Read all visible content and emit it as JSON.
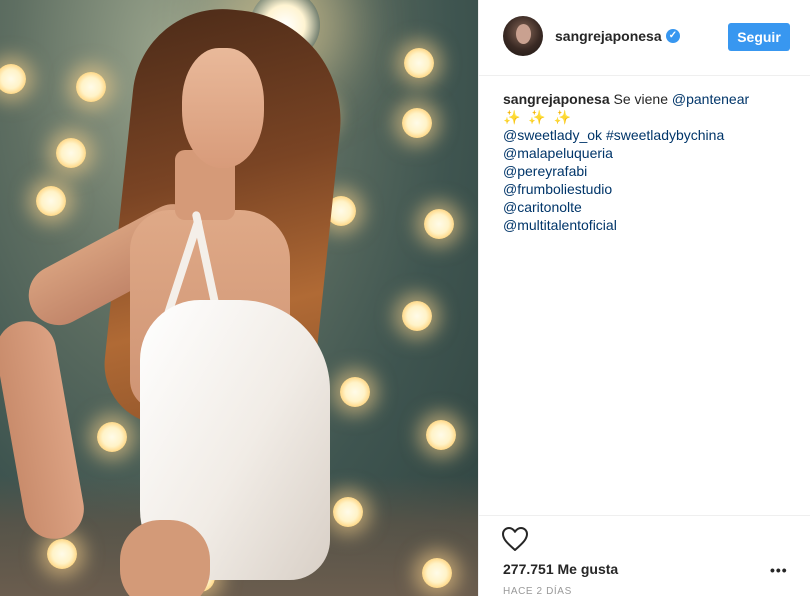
{
  "post": {
    "photo_alt": "",
    "author": {
      "username": "sangrejaponesa",
      "verified_icon": "check-icon"
    },
    "follow_label": "Seguir",
    "caption": {
      "author": "sangrejaponesa",
      "text": "Se viene",
      "mentions": [
        "@pantenear",
        "@sweetlady_ok",
        "#sweetladybychina",
        "@malapeluqueria",
        "@pereyrafabi",
        "@frumboliestudio",
        "@caritonolte",
        "@multitalentoficial"
      ],
      "sparkles": "✨ ✨ ✨"
    },
    "likes": "277.751 Me gusta",
    "timestamp": "HACE 2 DÍAS",
    "more_icon": "ellipsis-icon",
    "like_icon": "heart-icon"
  },
  "colors": {
    "accent": "#3897f0",
    "link": "#003569",
    "text": "#262626",
    "muted": "#999999"
  }
}
